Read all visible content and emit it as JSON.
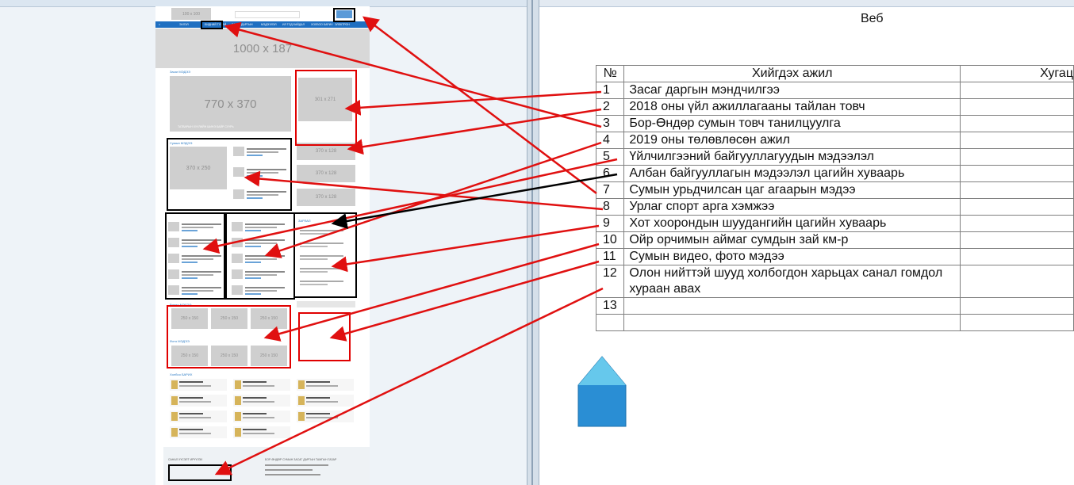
{
  "right": {
    "title": "Веб",
    "table": {
      "headers": [
        "№",
        "Хийгдэх ажил",
        "Хугац"
      ],
      "rows": [
        {
          "num": "1",
          "task": "Засаг даргын мэндчилгээ"
        },
        {
          "num": "2",
          "task": "2018 оны үйл ажиллагааны тайлан товч"
        },
        {
          "num": "3",
          "task": "Бор-Өндөр сумын товч танилцуулга"
        },
        {
          "num": "4",
          "task": "2019 оны төлөвлөсөн ажил"
        },
        {
          "num": "5",
          "task": "Үйлчилгээний байгууллагуудын мэдээлэл"
        },
        {
          "num": "6",
          "task": "Албан байгууллагын мэдээлэл цагийн хуваарь"
        },
        {
          "num": "7",
          "task": "Сумын урьдчилсан цаг агаарын мэдээ"
        },
        {
          "num": "8",
          "task": "Урлаг спорт арга хэмжээ"
        },
        {
          "num": "9",
          "task": "Хот хоорондын шуудангийн цагийн хуваарь"
        },
        {
          "num": "10",
          "task": "Ойр орчимын аймаг сумдын зай км-р"
        },
        {
          "num": "11",
          "task": "Сумын видео, фото мэдээ"
        },
        {
          "num": "12",
          "task": "Олон нийттэй шууд холбогдон харьцах санал гомдол хураан авах"
        },
        {
          "num": "13",
          "task": ""
        },
        {
          "num": "",
          "task": ""
        }
      ]
    }
  },
  "mockup": {
    "top_logo": "100 x 100",
    "nav": [
      "ЭХЛЭЛ",
      "БИДНИЙ ТУХАЙ",
      "ЗАСАГ ДАРГЫН",
      "МЭДЭЭЛЭЛ",
      "ИЛ ТОД БАЙДАЛ",
      "ХОЛБОО БАРИХ",
      "ЭЛЕКТРОН"
    ],
    "banner": "1000 x 187",
    "hero": "770 x 370",
    "hero_caption": "ТАТВАРЫН ХУУЛИЙН ШИНЭ БАЙР СУУРЬ",
    "side_box": "301 x 271",
    "news_main": "370 x 250",
    "small_box_1": "370 x 128",
    "small_box_2": "370 x 128",
    "small_box_3": "370 x 128",
    "gallery": [
      "250 x 150",
      "250 x 150",
      "250 x 150",
      "250 x 150",
      "250 x 150",
      "250 x 150"
    ],
    "section_1": "Засаг МЭДЭЭ",
    "section_2": "Сумын МЭДЭЭ",
    "section_3": "ЗАРЛАЛ",
    "section_4": "Видео МЭДЭЭ",
    "section_5": "Фото МЭДЭЭ",
    "section_6": "Холбоо БАРИХ",
    "footer_left": "САНАЛ ХҮСЭЛТ ИРҮҮЛЭХ",
    "footer_right": "БОР-ӨНДӨР СУМЫН ЗАСАГ ДАРГЫН ТАМГЫН ГАЗАР"
  },
  "colors": {
    "nav_blue": "#1f6fc1",
    "arrow_red": "#e01010",
    "arrow_black": "#000000",
    "shape_blue": "#2a8ed4",
    "shape_top": "#66c8ec"
  }
}
